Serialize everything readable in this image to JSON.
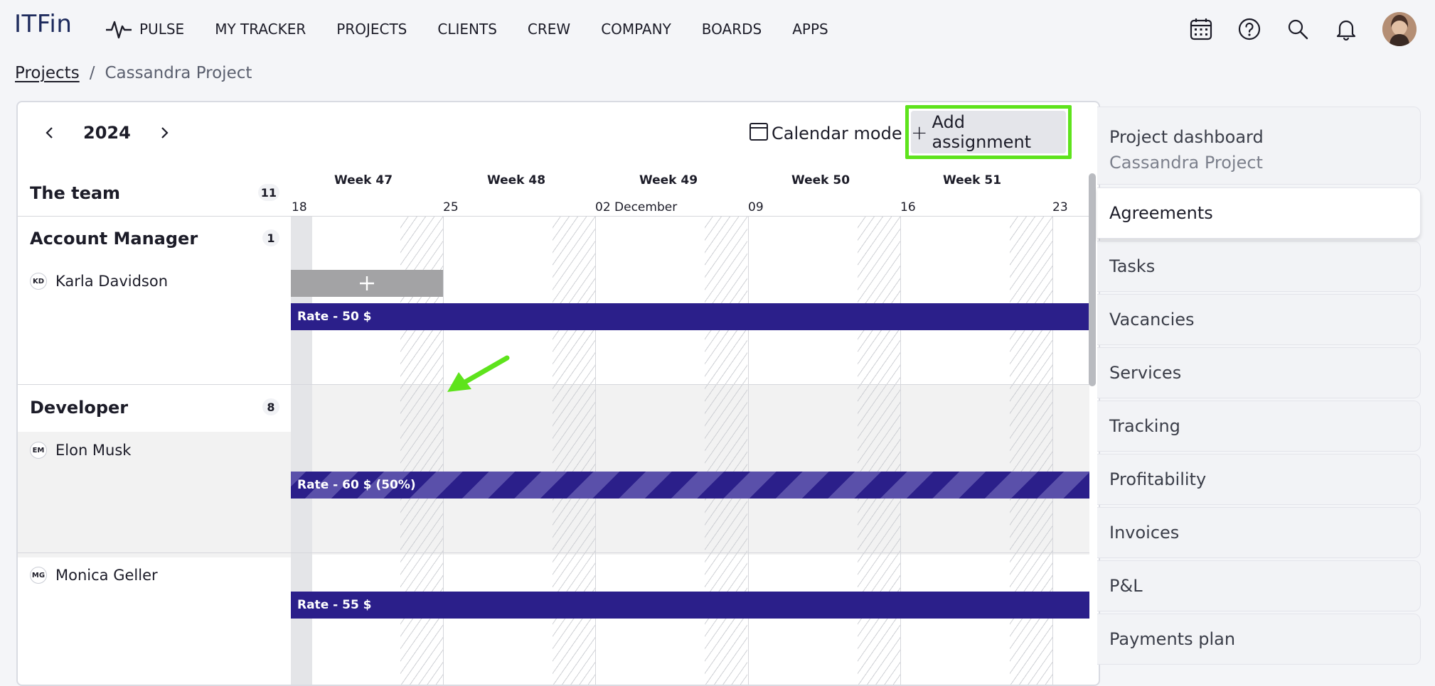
{
  "app": {
    "logo": "ITFin"
  },
  "nav": {
    "pulse": "PULSE",
    "my_tracker": "MY TRACKER",
    "projects": "PROJECTS",
    "clients": "CLIENTS",
    "crew": "CREW",
    "company": "COMPANY",
    "boards": "BOARDS",
    "apps": "APPS"
  },
  "breadcrumb": {
    "root": "Projects",
    "separator": "/",
    "current": "Cassandra Project"
  },
  "toolbar": {
    "year": "2024",
    "calendar_mode": "Calendar mode",
    "add_assignment": "Add assignment",
    "add_assignment_icon": "+"
  },
  "timeline": {
    "weeks": [
      "Week 47",
      "Week 48",
      "Week 49",
      "Week 50",
      "Week 51"
    ],
    "days": [
      "18",
      "25",
      "02 December",
      "09",
      "16",
      "23"
    ]
  },
  "team": {
    "title": "The team",
    "count": "11",
    "groups": [
      {
        "title": "Account Manager",
        "count": "1",
        "members": [
          {
            "initials": "KD",
            "name": "Karla Davidson",
            "bar": "Rate - 50 $"
          }
        ]
      },
      {
        "title": "Developer",
        "count": "8",
        "members": [
          {
            "initials": "EM",
            "name": "Elon Musk",
            "bar": "Rate - 60 $ (50%)"
          },
          {
            "initials": "MG",
            "name": "Monica Geller",
            "bar": "Rate - 55 $"
          }
        ]
      }
    ]
  },
  "sidebar": {
    "dashboard_title": "Project dashboard",
    "dashboard_subtitle": "Cassandra Project",
    "items": [
      "Agreements",
      "Tasks",
      "Vacancies",
      "Services",
      "Tracking",
      "Profitability",
      "Invoices",
      "P&L",
      "Payments plan"
    ],
    "active": "Agreements"
  },
  "colors": {
    "accent_bar": "#2b1f8a",
    "highlight": "#5ee31c",
    "arrow": "#5ee31c"
  }
}
